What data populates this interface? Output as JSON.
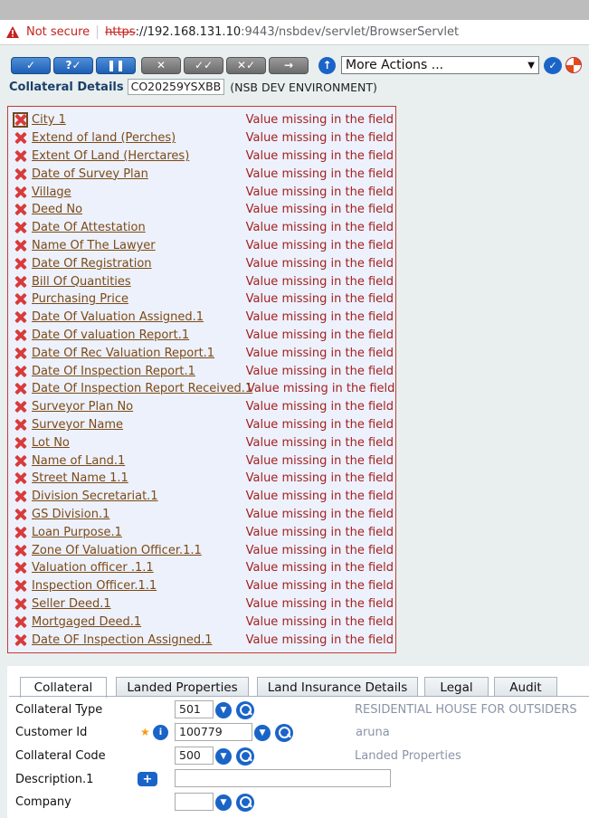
{
  "browser": {
    "security_label": "Not secure",
    "url_scheme": "https",
    "url_host": "://192.168.131.10",
    "url_rest": ":9443/nsbdev/servlet/BrowserServlet"
  },
  "toolbar": {
    "actions_select": "More Actions ...",
    "buttons": [
      "✓",
      "?✓",
      "❚❚",
      "✕",
      "✓✓",
      "✕✓",
      "→"
    ]
  },
  "header": {
    "label": "Collateral Details",
    "record_id": "CO20259YSXBB",
    "environment": "(NSB DEV ENVIRONMENT)"
  },
  "errors": {
    "message": "Value missing in the field",
    "fields": [
      "City 1",
      "Extend of land (Perches)",
      "Extent Of Land (Herctares)",
      "Date of Survey Plan",
      "Village",
      "Deed No",
      "Date Of Attestation",
      "Name Of The Lawyer",
      "Date Of Registration",
      "Bill Of Quantities",
      "Purchasing Price",
      "Date Of Valuation Assigned.1",
      "Date Of valuation Report.1",
      "Date Of Rec Valuation Report.1",
      "Date Of Inspection Report.1",
      "Date Of Inspection Report Received.1",
      "Surveyor Plan No",
      "Surveyor Name",
      "Lot No",
      "Name of Land.1",
      "Street Name 1.1",
      "Division Secretariat.1",
      "GS Division.1",
      "Loan Purpose.1",
      "Zone Of Valuation Officer.1.1",
      "Valuation officer .1.1",
      "Inspection Officer.1.1",
      "Seller Deed.1",
      "Mortgaged Deed.1",
      "Date OF Inspection Assigned.1"
    ]
  },
  "tabs": [
    "Collateral",
    "Landed Properties",
    "Land Insurance Details",
    "Legal",
    "Audit"
  ],
  "form": {
    "collateral_type": {
      "label": "Collateral Type",
      "value": "501",
      "description": "RESIDENTIAL HOUSE FOR OUTSIDERS"
    },
    "customer_id": {
      "label": "Customer Id",
      "value": "100779",
      "description": "aruna"
    },
    "collateral_code": {
      "label": "Collateral Code",
      "value": "500",
      "description": "Landed Properties"
    },
    "description": {
      "label": "Description.1",
      "value": ""
    },
    "company": {
      "label": "Company",
      "value": ""
    }
  },
  "colors": {
    "error_red": "#a32020",
    "link_brown": "#7c4a17",
    "accent_blue": "#1a64c8"
  }
}
